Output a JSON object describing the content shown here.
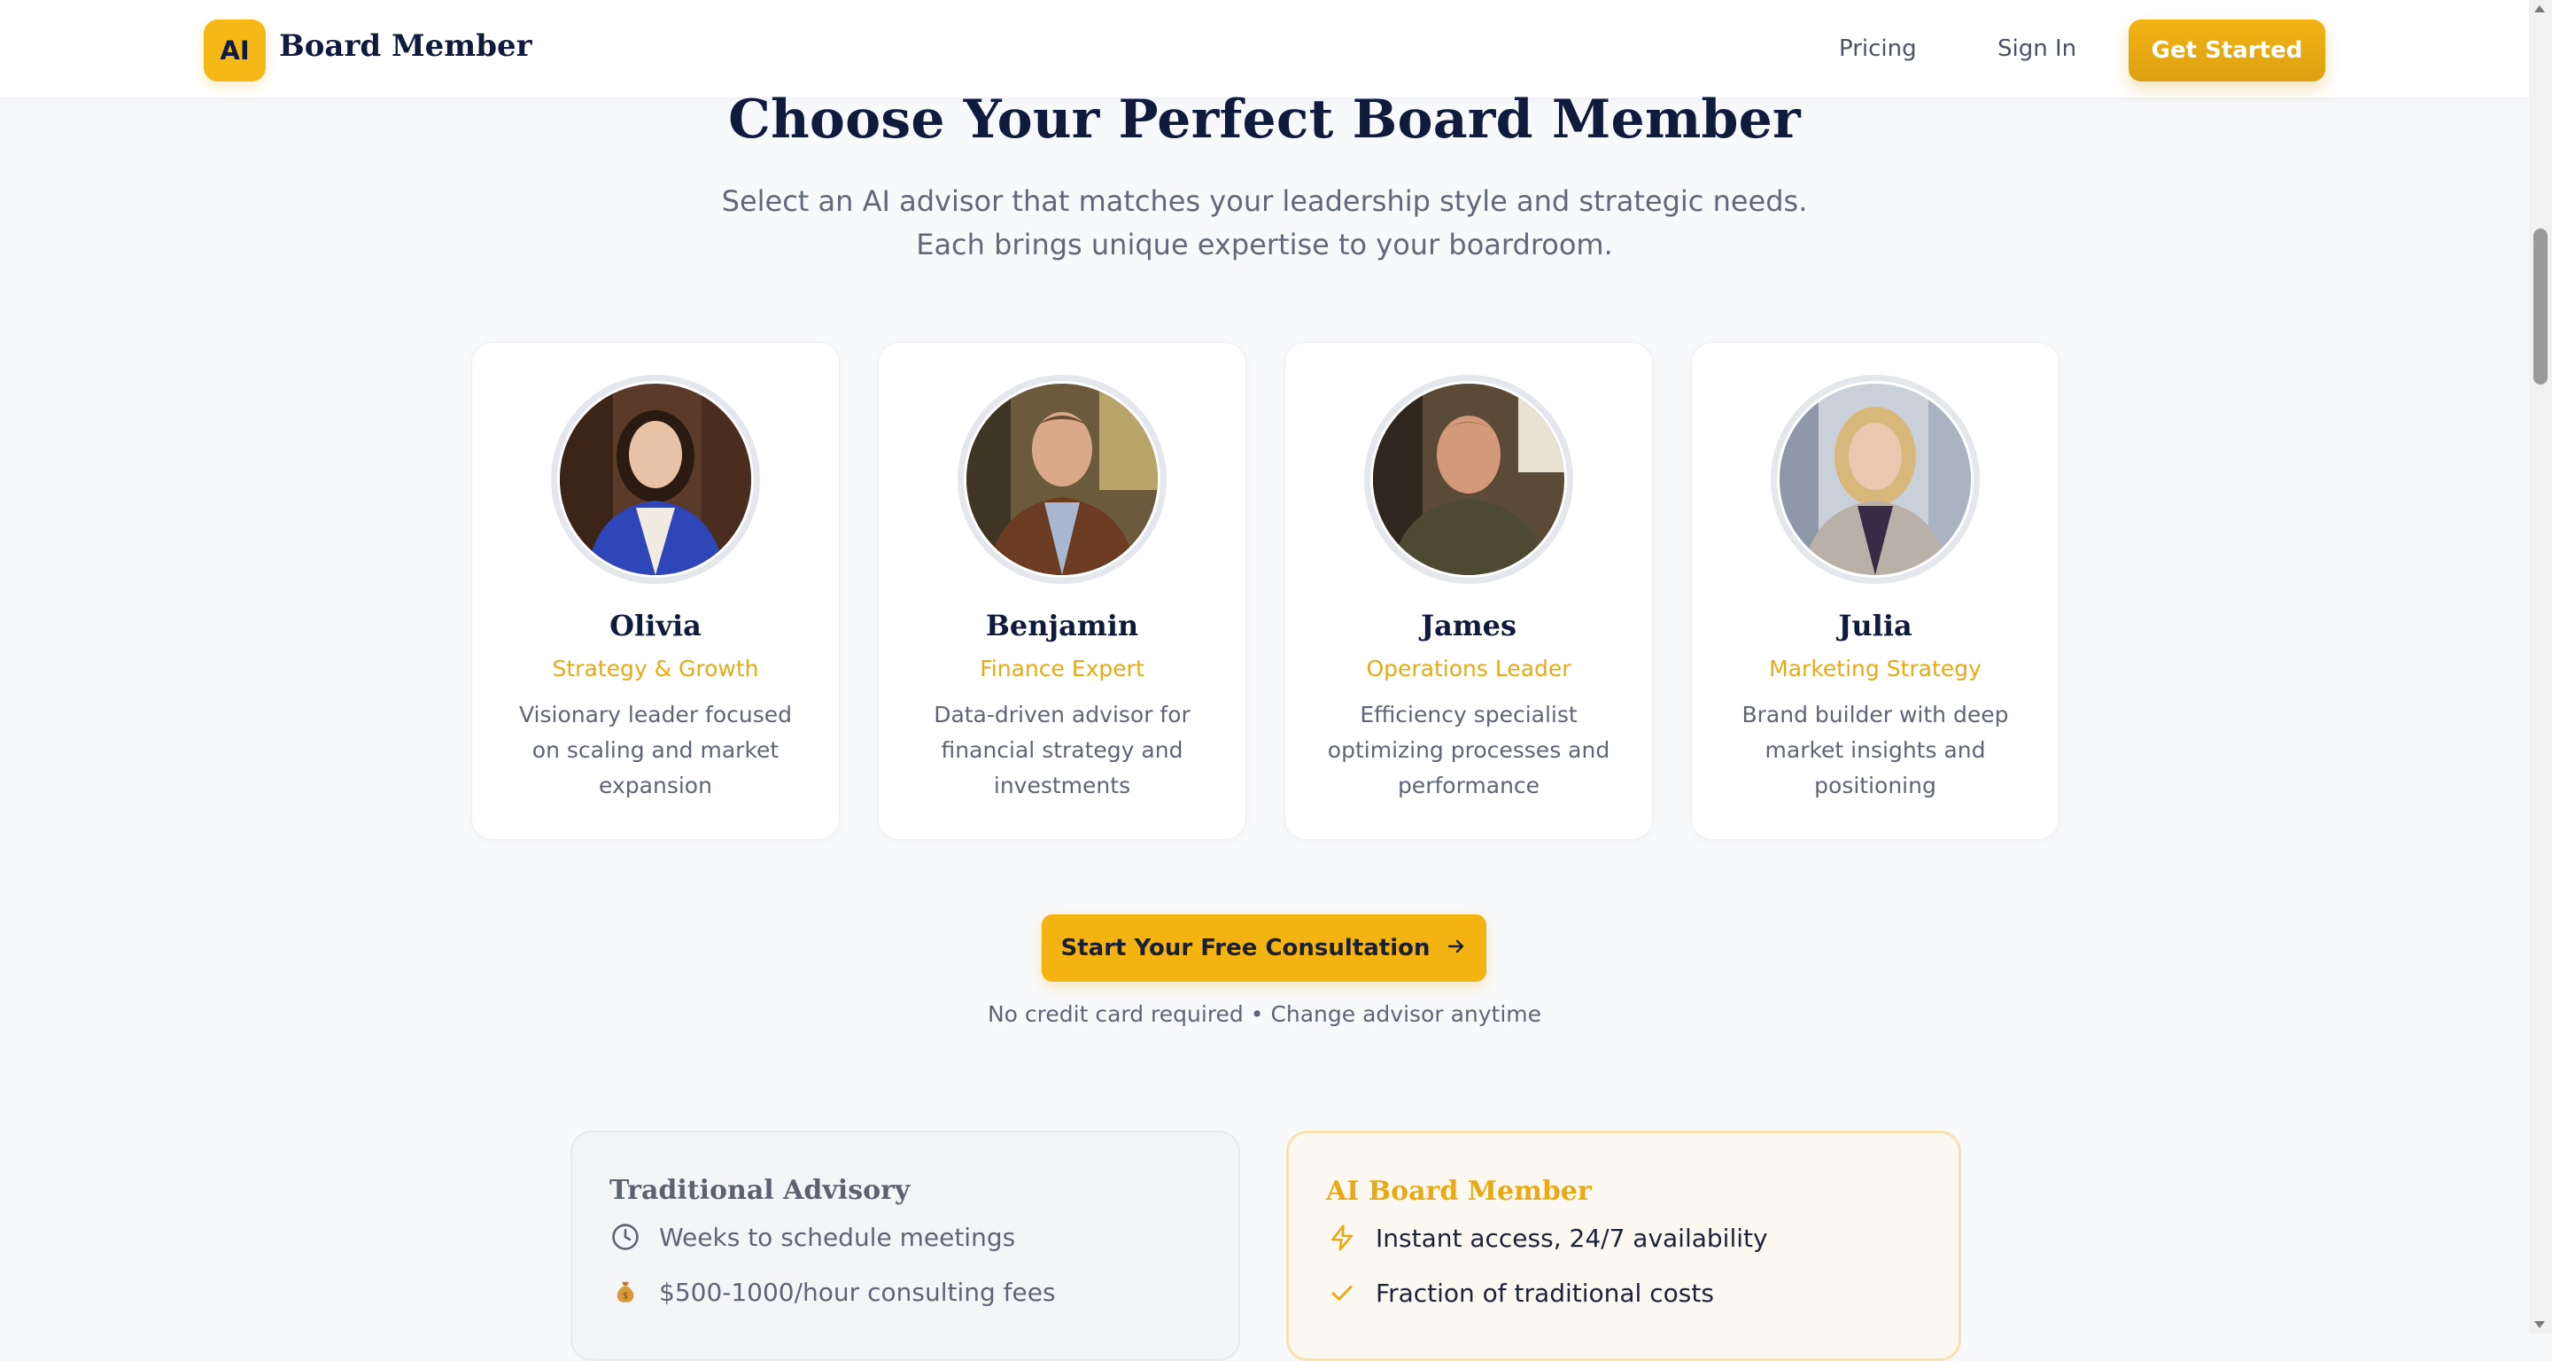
{
  "nav": {
    "logo_badge": "AI",
    "brand": "Board Member",
    "links": {
      "pricing": "Pricing",
      "sign_in": "Sign In"
    },
    "cta": "Get Started"
  },
  "hero": {
    "title": "Choose Your Perfect Board Member",
    "subtitle_line1": "Select an AI advisor that matches your leadership style and strategic needs.",
    "subtitle_line2": "Each brings unique expertise to your boardroom."
  },
  "advisors": [
    {
      "name": "Olivia",
      "role": "Strategy & Growth",
      "description": "Visionary leader focused on scaling and market expansion"
    },
    {
      "name": "Benjamin",
      "role": "Finance Expert",
      "description": "Data-driven advisor for financial strategy and investments"
    },
    {
      "name": "James",
      "role": "Operations Leader",
      "description": "Efficiency specialist optimizing processes and performance"
    },
    {
      "name": "Julia",
      "role": "Marketing Strategy",
      "description": "Brand builder with deep market insights and positioning"
    }
  ],
  "cta": {
    "label": "Start Your Free Consultation",
    "note": "No credit card required • Change advisor anytime"
  },
  "comparison": {
    "traditional": {
      "title": "Traditional Advisory",
      "items": [
        {
          "icon": "clock-icon",
          "text": "Weeks to schedule meetings"
        },
        {
          "icon": "money-bag-icon",
          "text": "$500-1000/hour consulting fees"
        }
      ]
    },
    "ai": {
      "title": "AI Board Member",
      "items": [
        {
          "icon": "lightning-icon",
          "text": "Instant access, 24/7 availability"
        },
        {
          "icon": "check-icon",
          "text": "Fraction of traditional costs"
        }
      ]
    }
  },
  "colors": {
    "accent": "#f3b311",
    "navy": "#0f1b3d",
    "muted_text": "#5d6576",
    "page_bg": "#f8f9fb"
  }
}
